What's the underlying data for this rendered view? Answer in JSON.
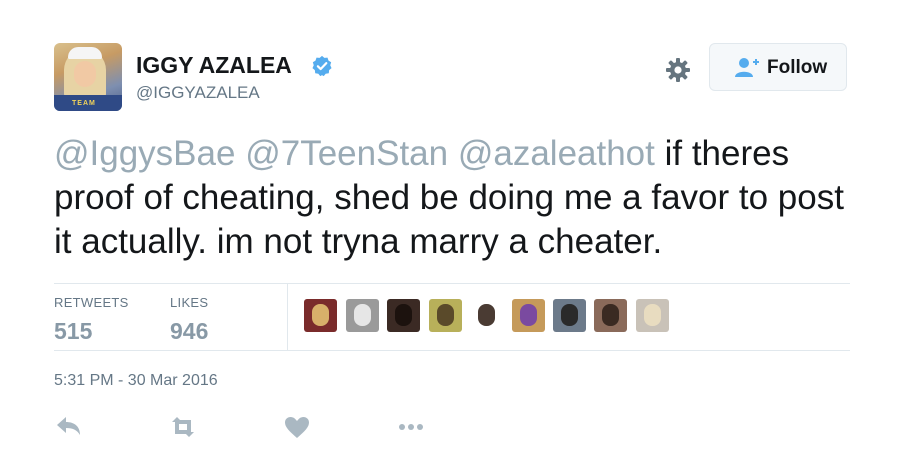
{
  "author": {
    "display_name": "IGGY AZALEA",
    "handle": "@IGGYAZALEA",
    "verified_icon": "verified-badge-icon",
    "avatar_badge_text": "TEAM"
  },
  "header": {
    "settings_icon": "gear-icon",
    "follow_label": "Follow",
    "follow_icon": "add-user-icon"
  },
  "tweet": {
    "mentions": [
      "@IggysBae",
      "@7TeenStan",
      "@azaleathot"
    ],
    "text": "if theres proof of cheating, shed be doing me a favor to post it actually. im not tryna marry a cheater."
  },
  "stats": {
    "retweets_label": "RETWEETS",
    "retweets_count": "515",
    "likes_label": "LIKES",
    "likes_count": "946"
  },
  "likers": [
    {
      "bg": "#7a2b2b",
      "hair": "#d8b06a"
    },
    {
      "bg": "#9a9a9a",
      "hair": "#e6e6e6"
    },
    {
      "bg": "#3b2a24",
      "hair": "#1c120e"
    },
    {
      "bg": "#b8b05a",
      "hair": "#5a4a2a"
    },
    {
      "bg": "#ffffff",
      "hair": "#4a3b33"
    },
    {
      "bg": "#c59a5a",
      "hair": "#7a4aa0"
    },
    {
      "bg": "#6c7a8a",
      "hair": "#2a2a2a"
    },
    {
      "bg": "#8a6a5a",
      "hair": "#3a2a22"
    },
    {
      "bg": "#c9c2b8",
      "hair": "#e8dcc0"
    }
  ],
  "timestamp": "5:31 PM - 30 Mar 2016",
  "actions": {
    "reply_icon": "reply-icon",
    "retweet_icon": "retweet-icon",
    "like_icon": "heart-icon",
    "more_icon": "more-icon"
  },
  "colors": {
    "mention": "#99aab5",
    "text": "#14171a",
    "muted": "#657786",
    "verified": "#55acee",
    "action": "#aab8c2"
  }
}
